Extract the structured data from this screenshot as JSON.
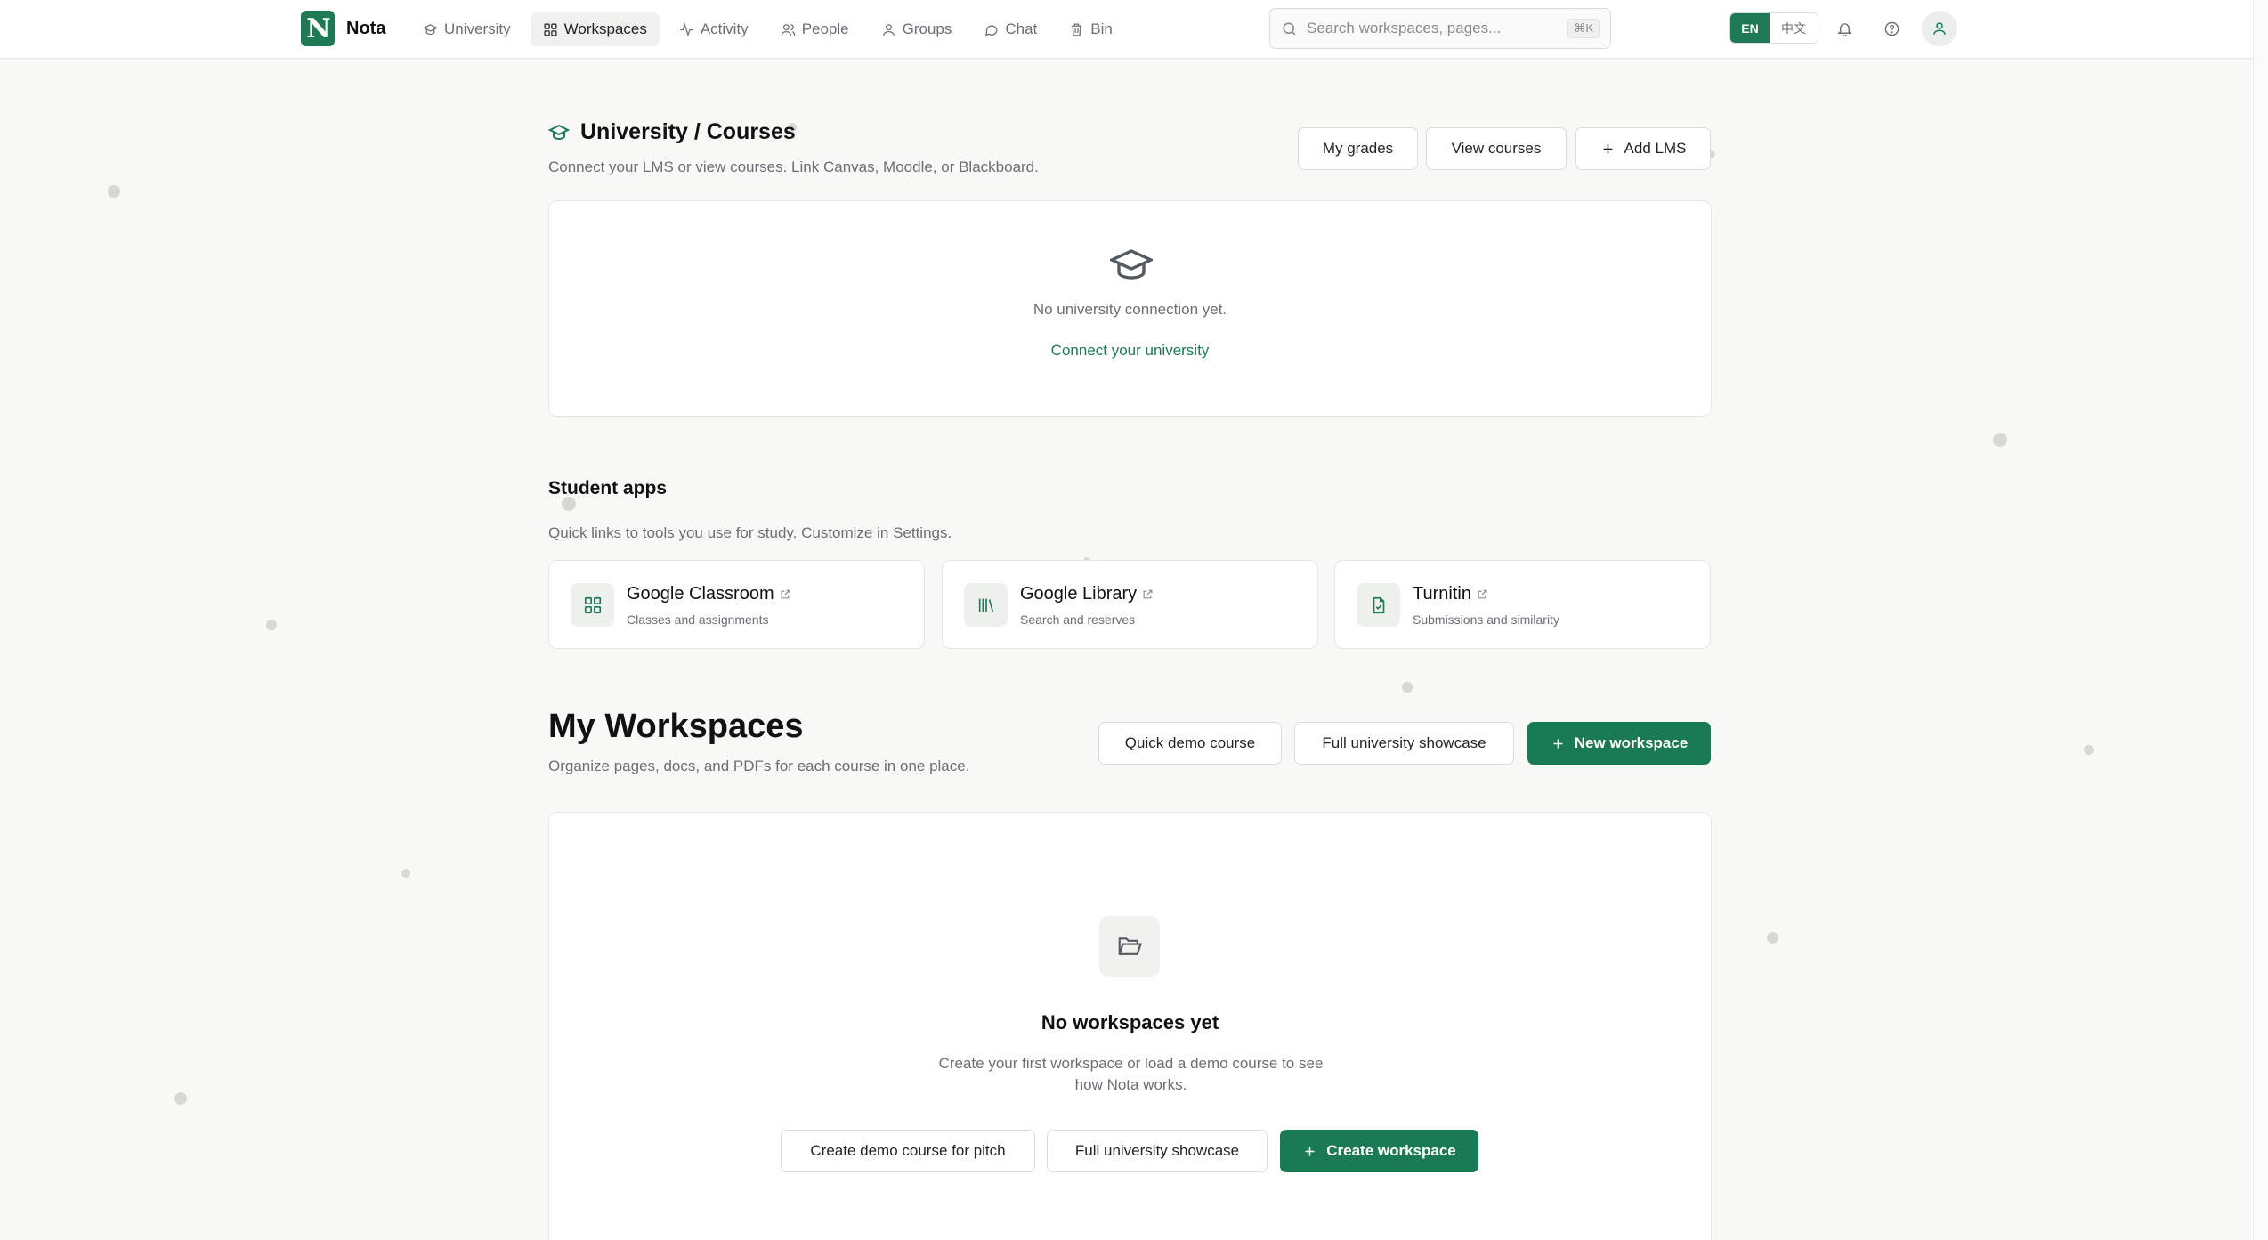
{
  "app": {
    "name": "Nota",
    "logo_letter": "N"
  },
  "nav": {
    "items": [
      {
        "label": "University",
        "icon": "graduation-cap-icon"
      },
      {
        "label": "Workspaces",
        "icon": "grid-icon",
        "active": true
      },
      {
        "label": "Activity",
        "icon": "activity-icon"
      },
      {
        "label": "People",
        "icon": "people-icon"
      },
      {
        "label": "Groups",
        "icon": "groups-icon"
      },
      {
        "label": "Chat",
        "icon": "chat-icon"
      },
      {
        "label": "Bin",
        "icon": "trash-icon"
      }
    ]
  },
  "search": {
    "placeholder": "Search workspaces, pages...",
    "shortcut": "⌘K"
  },
  "language": {
    "active": "EN",
    "other": "中文"
  },
  "colors": {
    "accent": "#1d7a55",
    "background": "#f8f8f7",
    "muted_text": "#6b6f76"
  },
  "university": {
    "title": "University / Courses",
    "description": "Connect your LMS or view courses. Link Canvas, Moodle, or Blackboard.",
    "buttons": {
      "grades": "My grades",
      "courses": "View courses",
      "add_lms": "Add LMS"
    },
    "empty_message": "No university connection yet.",
    "connect_link": "Connect your university"
  },
  "student_apps": {
    "title": "Student apps",
    "description": "Quick links to tools you use for study. Customize in Settings.",
    "apps": [
      {
        "name": "Google Classroom",
        "subtitle": "Classes and assignments",
        "icon": "grid-icon"
      },
      {
        "name": "Google Library",
        "subtitle": "Search and reserves",
        "icon": "library-icon"
      },
      {
        "name": "Turnitin",
        "subtitle": "Submissions and similarity",
        "icon": "document-check-icon"
      }
    ]
  },
  "workspaces": {
    "title": "My Workspaces",
    "description": "Organize pages, docs, and PDFs for each course in one place.",
    "buttons": {
      "quick_demo": "Quick demo course",
      "showcase": "Full university showcase",
      "new": "New workspace"
    },
    "empty": {
      "title": "No workspaces yet",
      "text": "Create your first workspace or load a demo course to see how Nota works.",
      "buttons": {
        "demo_pitch": "Create demo course for pitch",
        "showcase": "Full university showcase",
        "create": "Create workspace"
      }
    }
  }
}
